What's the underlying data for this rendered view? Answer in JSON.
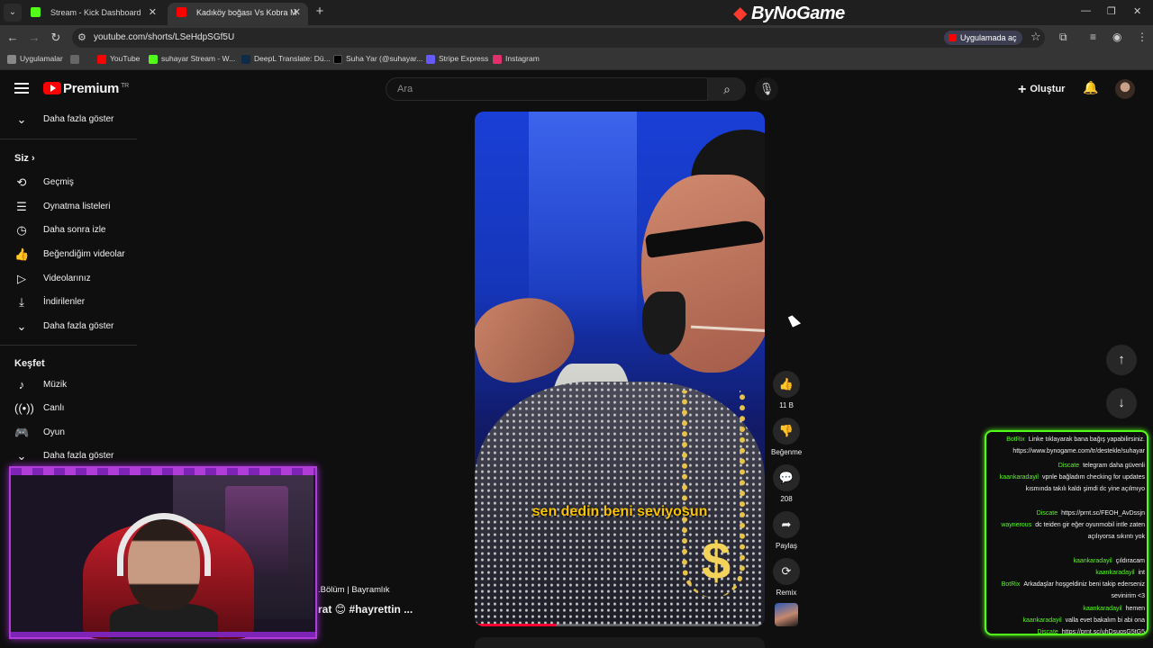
{
  "browser": {
    "tabs": [
      {
        "title": "Stream - Kick Dashboard",
        "favicon_color": "#53fc18"
      },
      {
        "title": "Kadıköy boğası Vs Kobra M",
        "favicon_color": "#ff0000"
      }
    ],
    "brand": "ByNoGame",
    "url": "youtube.com/shorts/LSeHdpSGf5U",
    "open_in_app": "Uygulamada aç",
    "bookmarks": [
      {
        "label": "Uygulamalar",
        "color": "#888888"
      },
      {
        "label": "YouTube",
        "color": "#ff0000"
      },
      {
        "label": "suhayar Stream - W...",
        "color": "#53fc18"
      },
      {
        "label": "DeepL Translate: Dü...",
        "color": "#0f2b46"
      },
      {
        "label": "Suha Yar (@suhayar...",
        "color": "#000000"
      },
      {
        "label": "Stripe Express",
        "color": "#635bff"
      },
      {
        "label": "Instagram",
        "color": "#e1306c"
      }
    ]
  },
  "youtube": {
    "logo_text": "Premium",
    "logo_sup": "TR",
    "search_placeholder": "Ara",
    "create_label": "Oluştur",
    "sidebar": {
      "show_more_top": "Daha fazla göster",
      "you_section": "Siz",
      "you_items": [
        "Geçmiş",
        "Oynatma listeleri",
        "Daha sonra izle",
        "Beğendiğim videolar",
        "Videolarınız",
        "İndirilenler"
      ],
      "show_more_you": "Daha fazla göster",
      "explore_section": "Keşfet",
      "explore_items": [
        "Müzik",
        "Canlı",
        "Oyun"
      ],
      "show_more_explore": "Daha fazla göster"
    },
    "short": {
      "caption": "sen dedin beni seviyosun",
      "progress": 0.28,
      "likes": "11 B",
      "dislike_label": "Beğenme",
      "comments": "208",
      "share_label": "Paylaş",
      "remix_label": "Remix"
    },
    "background_text": {
      "line1": ".Bölüm | Bayramlık",
      "line2": "rat 😊 #hayrettin ..."
    }
  },
  "chat": [
    {
      "user": "BotRix",
      "text": "Linke tıklayarak bana bağış yapabilirsiniz. https://www.bynogame.com/tr/destekle/suhayar"
    },
    {
      "user": "Discate",
      "text": "telegram daha güvenli"
    },
    {
      "user": "kaankaradayil",
      "text": "vpnle bağladım checking for updates kısmında takılı kaldı şimdi dc yine açılmıyo"
    },
    {
      "user": "Discate",
      "text": "https://prnt.sc/FEOH_AvDssjn"
    },
    {
      "user": "waynerous",
      "text": "dc teiden gir eğer oyunmobil intle zaten açılıyorsa sıkıntı yok"
    },
    {
      "user": "kaankaradayil",
      "text": "çıldıracam"
    },
    {
      "user": "kaankaradayil",
      "text": "int"
    },
    {
      "user": "BotRix",
      "text": "Arkadaşlar hoşgeldiniz beni takip ederseniz sevinirim <3"
    },
    {
      "user": "kaankaradayil",
      "text": "hemen"
    },
    {
      "user": "kaankaradayil",
      "text": "valla evet bakalım bi abi ona"
    },
    {
      "user": "Discate",
      "text": "https://prnt.sc/uhDsugsG5tG5"
    }
  ],
  "colors": {
    "accent_red": "#ff0000",
    "kick_green": "#53fc18",
    "overlay_purple": "#b13dd8",
    "caption_yellow": "#f8c200"
  }
}
